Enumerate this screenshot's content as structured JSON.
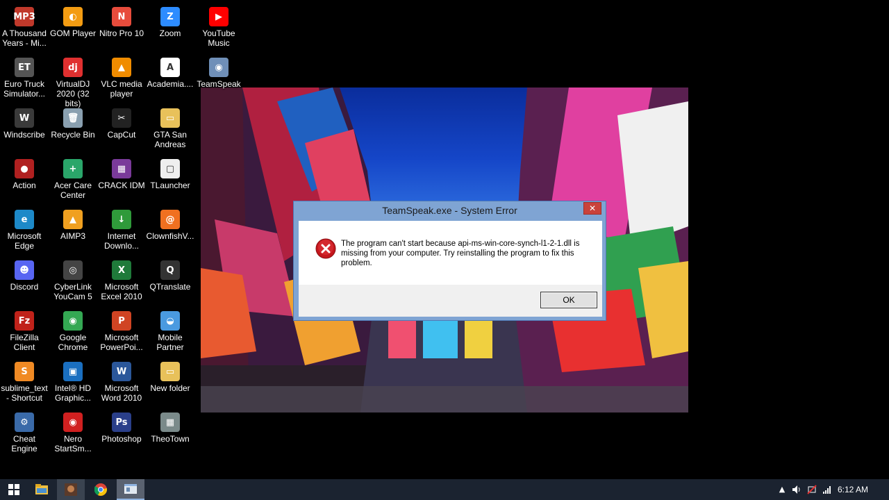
{
  "desktop": {
    "icons": [
      {
        "label": "A Thousand Years - Mi...",
        "glyph": "MP3",
        "color": "#c0392b"
      },
      {
        "label": "GOM Player",
        "glyph": "◐",
        "color": "#f39c12"
      },
      {
        "label": "Nitro Pro 10",
        "glyph": "N",
        "color": "#e74c3c"
      },
      {
        "label": "Zoom",
        "glyph": "Z",
        "color": "#2d8cff"
      },
      {
        "label": "YouTube Music",
        "glyph": "▶",
        "color": "#ff0000"
      },
      {
        "label": "Euro Truck Simulator...",
        "glyph": "ET",
        "color": "#555555"
      },
      {
        "label": "VirtualDJ 2020 (32 bits)",
        "glyph": "dj",
        "color": "#e03030"
      },
      {
        "label": "VLC media player",
        "glyph": "▲",
        "color": "#f08c00"
      },
      {
        "label": "Academia....",
        "glyph": "A",
        "color": "#ffffff"
      },
      {
        "label": "TeamSpeak",
        "glyph": "◉",
        "color": "#6f8fb8"
      },
      {
        "label": "Windscribe",
        "glyph": "W",
        "color": "#3a3a3a"
      },
      {
        "label": "Recycle Bin",
        "glyph": "🗑",
        "color": "#8aa0b0"
      },
      {
        "label": "CapCut",
        "glyph": "✂",
        "color": "#222222"
      },
      {
        "label": "GTA San Andreas",
        "glyph": "▭",
        "color": "#e8c15a"
      },
      {
        "label": "Action",
        "glyph": "●",
        "color": "#b02020"
      },
      {
        "label": "Acer Care Center",
        "glyph": "+",
        "color": "#2aa66a"
      },
      {
        "label": "CRACK IDM",
        "glyph": "▦",
        "color": "#7a3a9a"
      },
      {
        "label": "TLauncher",
        "glyph": "▢",
        "color": "#eeeeee"
      },
      {
        "label": "Microsoft Edge",
        "glyph": "e",
        "color": "#1d89c8"
      },
      {
        "label": "AIMP3",
        "glyph": "▲",
        "color": "#f0a020"
      },
      {
        "label": "Internet Downlo...",
        "glyph": "↓",
        "color": "#2f9a3a"
      },
      {
        "label": "ClownfishV...",
        "glyph": "@",
        "color": "#f07020"
      },
      {
        "label": "Discord",
        "glyph": "☻",
        "color": "#5865f2"
      },
      {
        "label": "CyberLink YouCam 5",
        "glyph": "◎",
        "color": "#444444"
      },
      {
        "label": "Microsoft Excel 2010",
        "glyph": "X",
        "color": "#1f7a3a"
      },
      {
        "label": "QTranslate",
        "glyph": "Q",
        "color": "#333333"
      },
      {
        "label": "FileZilla Client",
        "glyph": "Fz",
        "color": "#c0221a"
      },
      {
        "label": "Google Chrome",
        "glyph": "◉",
        "color": "#34a853"
      },
      {
        "label": "Microsoft PowerPoi...",
        "glyph": "P",
        "color": "#d04423"
      },
      {
        "label": "Mobile Partner",
        "glyph": "◒",
        "color": "#4a9ae0"
      },
      {
        "label": "sublime_text - Shortcut",
        "glyph": "S",
        "color": "#f08a24"
      },
      {
        "label": "Intel® HD Graphic...",
        "glyph": "▣",
        "color": "#1a6fc0"
      },
      {
        "label": "Microsoft Word 2010",
        "glyph": "W",
        "color": "#2b579a"
      },
      {
        "label": "New folder",
        "glyph": "▭",
        "color": "#e8c15a"
      },
      {
        "label": "Cheat Engine",
        "glyph": "⚙",
        "color": "#3a6aa8"
      },
      {
        "label": "Nero StartSm...",
        "glyph": "◉",
        "color": "#d02020"
      },
      {
        "label": "Photoshop",
        "glyph": "Ps",
        "color": "#2a3f8a"
      },
      {
        "label": "TheoTown",
        "glyph": "▦",
        "color": "#7a8a8a"
      }
    ]
  },
  "dialog": {
    "title": "TeamSpeak.exe - System Error",
    "close_label": "✕",
    "message": "The program can't start because api-ms-win-core-synch-l1-2-1.dll is missing from your computer. Try reinstalling the program to fix this problem.",
    "ok_label": "OK",
    "icon": "error-icon"
  },
  "taskbar": {
    "start_icon": "windows-logo-icon",
    "pinned": [
      "file-explorer-icon",
      "game-app-icon",
      "chrome-icon",
      "error-window-icon"
    ],
    "tray": {
      "time": "6:12 AM",
      "icons": [
        "chevron-up-icon",
        "volume-icon",
        "network-icon",
        "signal-icon"
      ]
    }
  }
}
